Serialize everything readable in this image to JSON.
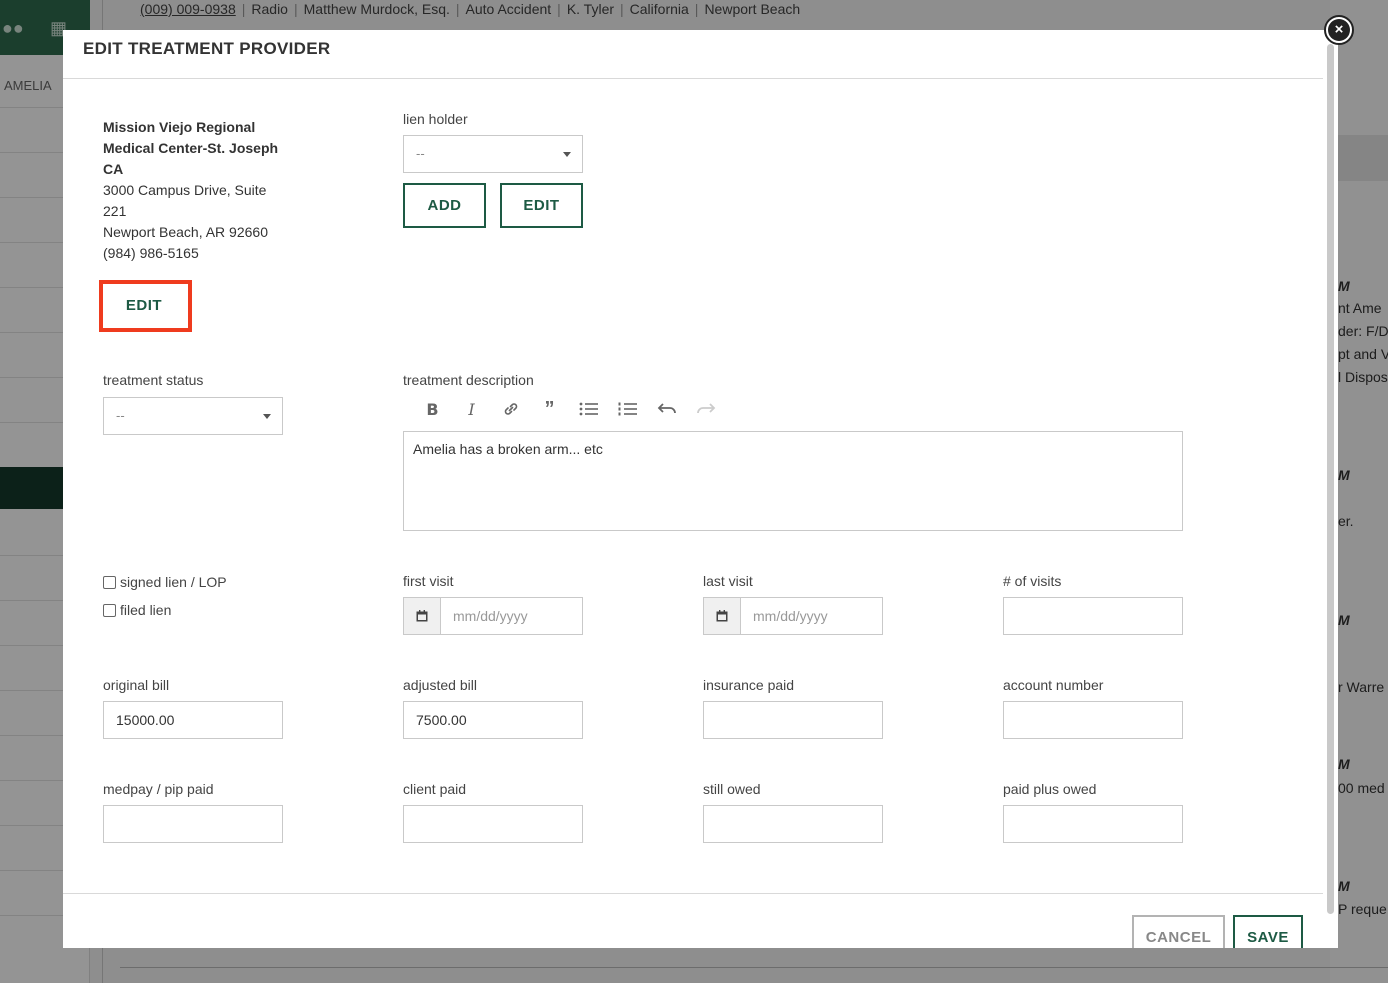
{
  "background": {
    "topbar": {
      "phone": "(009) 009-0938",
      "items": [
        "Radio",
        "Matthew Murdock, Esq.",
        "Auto Accident",
        "K. Tyler",
        "California",
        "Newport Beach"
      ]
    },
    "sidebar_name": "AMELIA",
    "right_snippets": [
      "M",
      "nt Ame",
      "der: F/D",
      "pt and V",
      "l Dispos",
      "M",
      "er.",
      "M",
      "r Warre",
      "M",
      "00 med",
      "M",
      "P reque"
    ]
  },
  "modal": {
    "title": "EDIT TREATMENT PROVIDER",
    "close_icon": "close-icon",
    "provider": {
      "name_line1": "Mission Viejo Regional",
      "name_line2": "Medical Center-St. Joseph",
      "name_line3": "CA",
      "address1": "3000 Campus Drive, Suite",
      "address2": "221",
      "city_state_zip": "Newport Beach, AR 92660",
      "phone": "(984) 986-5165",
      "edit_label": "EDIT",
      "highlight_color": "#ef3b1e"
    },
    "lien_holder": {
      "label": "lien holder",
      "selected": "--",
      "add_label": "ADD",
      "edit_label": "EDIT"
    },
    "treatment_status": {
      "label": "treatment status",
      "selected": "--"
    },
    "treatment_description": {
      "label": "treatment description",
      "toolbar": [
        "bold-icon",
        "italic-icon",
        "link-icon",
        "quote-icon",
        "bulleted-list-icon",
        "numbered-list-icon",
        "undo-icon",
        "redo-icon"
      ],
      "value": "Amelia has a broken arm... etc"
    },
    "checkboxes": {
      "signed_lien": "signed lien / LOP",
      "filed_lien": "filed lien"
    },
    "first_visit": {
      "label": "first visit",
      "placeholder": "mm/dd/yyyy"
    },
    "last_visit": {
      "label": "last visit",
      "placeholder": "mm/dd/yyyy"
    },
    "num_visits": {
      "label": "# of visits",
      "value": ""
    },
    "original_bill": {
      "label": "original bill",
      "value": "15000.00"
    },
    "adjusted_bill": {
      "label": "adjusted bill",
      "value": "7500.00"
    },
    "insurance_paid": {
      "label": "insurance paid",
      "value": ""
    },
    "account_number": {
      "label": "account number",
      "value": ""
    },
    "medpay_pip_paid": {
      "label": "medpay / pip paid",
      "value": ""
    },
    "client_paid": {
      "label": "client paid",
      "value": ""
    },
    "still_owed": {
      "label": "still owed",
      "value": ""
    },
    "paid_plus_owed": {
      "label": "paid plus owed",
      "value": ""
    },
    "cancel_label": "CANCEL",
    "save_label": "SAVE",
    "accent_color": "#1d5a44"
  }
}
